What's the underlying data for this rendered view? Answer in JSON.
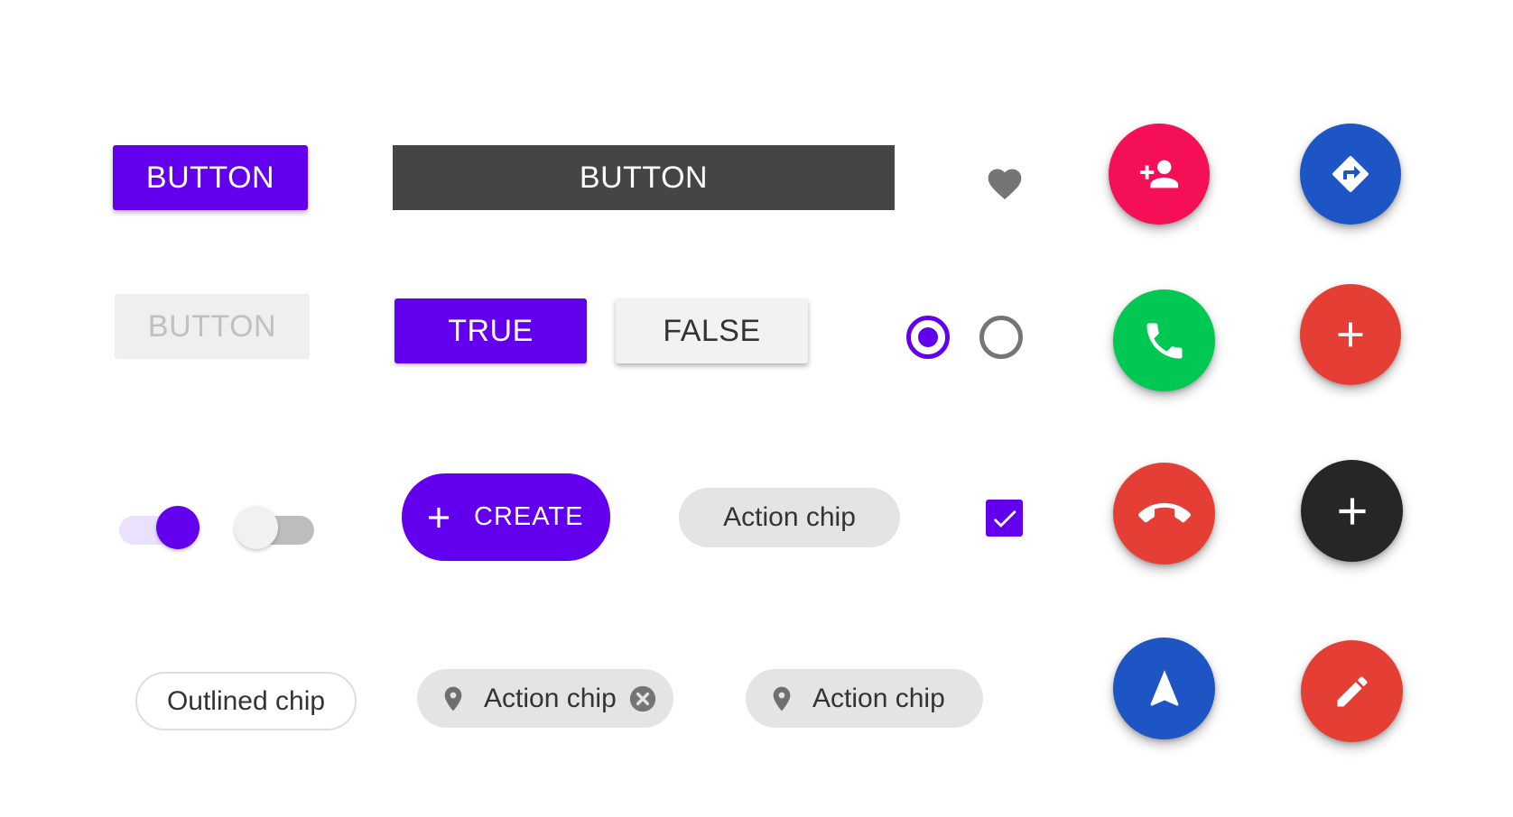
{
  "buttons": {
    "contained_label": "BUTTON",
    "wide_label": "BUTTON",
    "disabled_label": "BUTTON"
  },
  "toggle_group": {
    "true_label": "TRUE",
    "false_label": "FALSE"
  },
  "extended_fab": {
    "label": "CREATE",
    "icon": "plus-icon"
  },
  "chips": {
    "action_chip": "Action chip",
    "outlined_chip": "Outlined chip",
    "input_chip": {
      "label": "Action chip",
      "icon": "location-pin-icon",
      "close_icon": "cancel-icon"
    },
    "icon_chip": {
      "label": "Action chip",
      "icon": "location-pin-icon"
    }
  },
  "selection": {
    "favorite": {
      "icon": "heart-icon",
      "selected": true
    },
    "radio_selected": true,
    "radio_unselected": false,
    "checkbox_checked": true,
    "switch_on": true,
    "switch_off": false
  },
  "fabs": [
    {
      "name": "add-person-fab",
      "icon": "person-add-icon",
      "color": "#f50f57"
    },
    {
      "name": "directions-fab",
      "icon": "directions-icon",
      "color": "#1e55c4"
    },
    {
      "name": "call-fab",
      "icon": "phone-icon",
      "color": "#00c853"
    },
    {
      "name": "add-red-fab",
      "icon": "plus-icon",
      "color": "#e53f35"
    },
    {
      "name": "end-call-fab",
      "icon": "call-end-icon",
      "color": "#e53f35"
    },
    {
      "name": "add-dark-fab",
      "icon": "plus-icon",
      "color": "#262626"
    },
    {
      "name": "navigation-fab",
      "icon": "navigation-icon",
      "color": "#1e55c4"
    },
    {
      "name": "edit-fab",
      "icon": "pencil-icon",
      "color": "#e53f35"
    }
  ],
  "colors": {
    "primary": "#6200ee",
    "dark_button": "#454545",
    "disabled_bg": "#efefef",
    "disabled_text": "#c0c0c0",
    "chip_bg": "#e4e4e4",
    "icon_gray": "#757575"
  }
}
